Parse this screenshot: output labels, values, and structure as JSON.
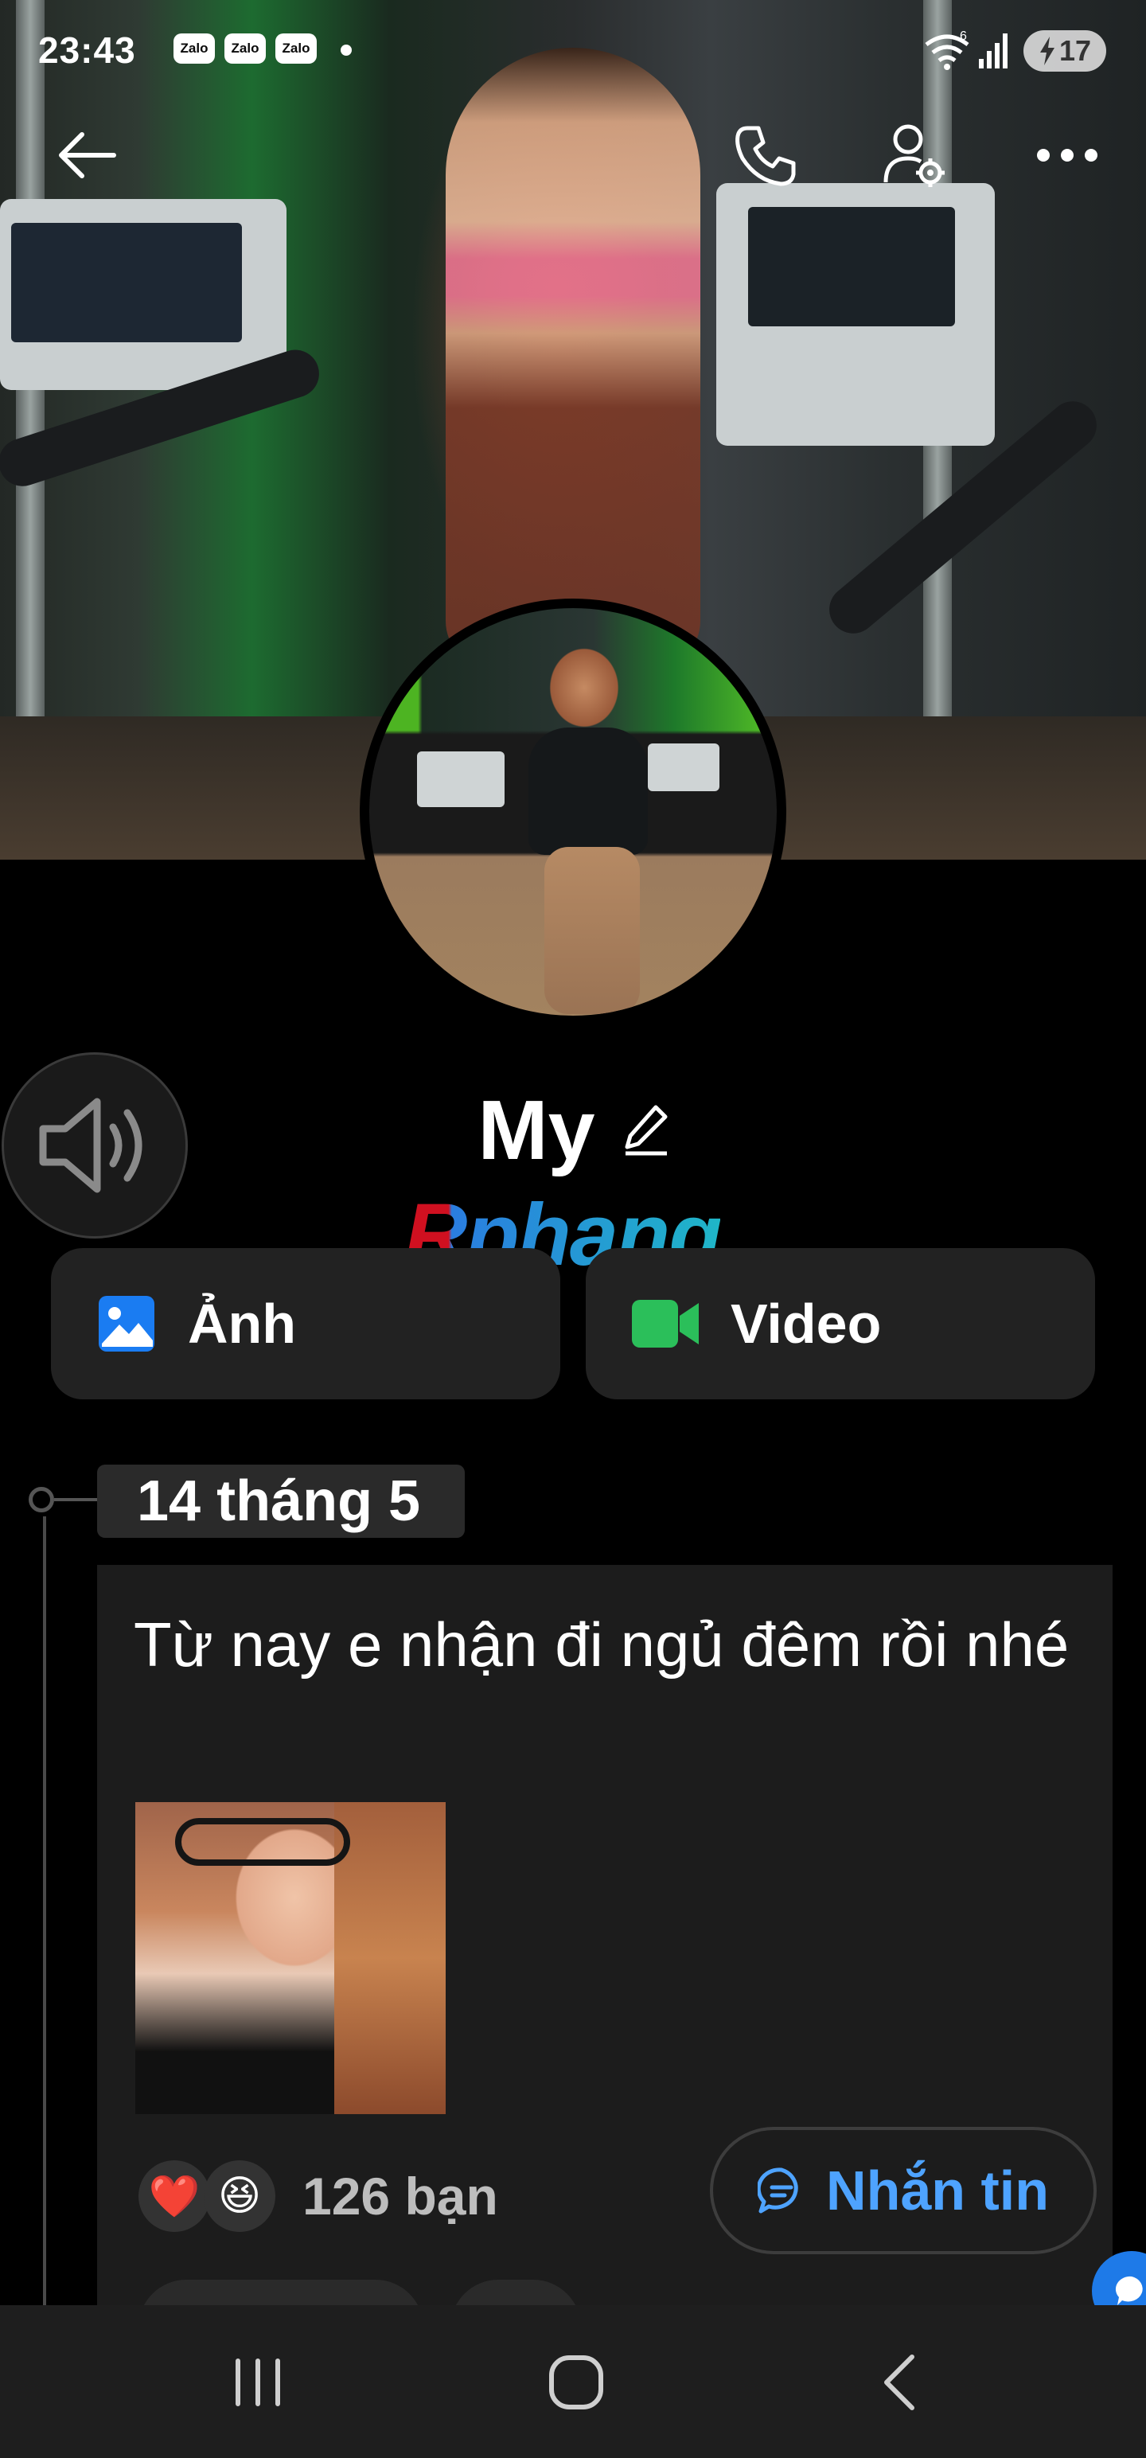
{
  "status_bar": {
    "time": "23:43",
    "notification_apps": [
      "Zalo",
      "Zalo",
      "Zalo"
    ],
    "wifi_label": "6",
    "battery_level": "17"
  },
  "top_nav": {
    "back_icon": "arrow-left-icon",
    "call_icon": "phone-icon",
    "profile_settings_icon": "user-gear-icon",
    "more_icon": "more-horizontal-icon"
  },
  "profile": {
    "name": "My",
    "edit_icon": "pencil-icon",
    "sound_icon": "speaker-icon"
  },
  "watermark": "Rphang",
  "media_buttons": [
    {
      "label": "Ảnh",
      "icon": "image-icon",
      "color": "#1a7cf2"
    },
    {
      "label": "Video",
      "icon": "video-camera-icon",
      "color": "#2bbf5a"
    }
  ],
  "timeline": {
    "date": "14 tháng 5",
    "post": {
      "text": "Từ nay e nhận đi ngủ đêm  rồi nhé",
      "reactions": [
        "❤️",
        "😆"
      ],
      "reaction_count": "126 bạn",
      "message_button": "Nhắn tin"
    }
  },
  "colors": {
    "background": "#000000",
    "card": "#1c1c1c",
    "accent_blue": "#4ea3ff",
    "nav_bar": "#1e1e1e"
  }
}
